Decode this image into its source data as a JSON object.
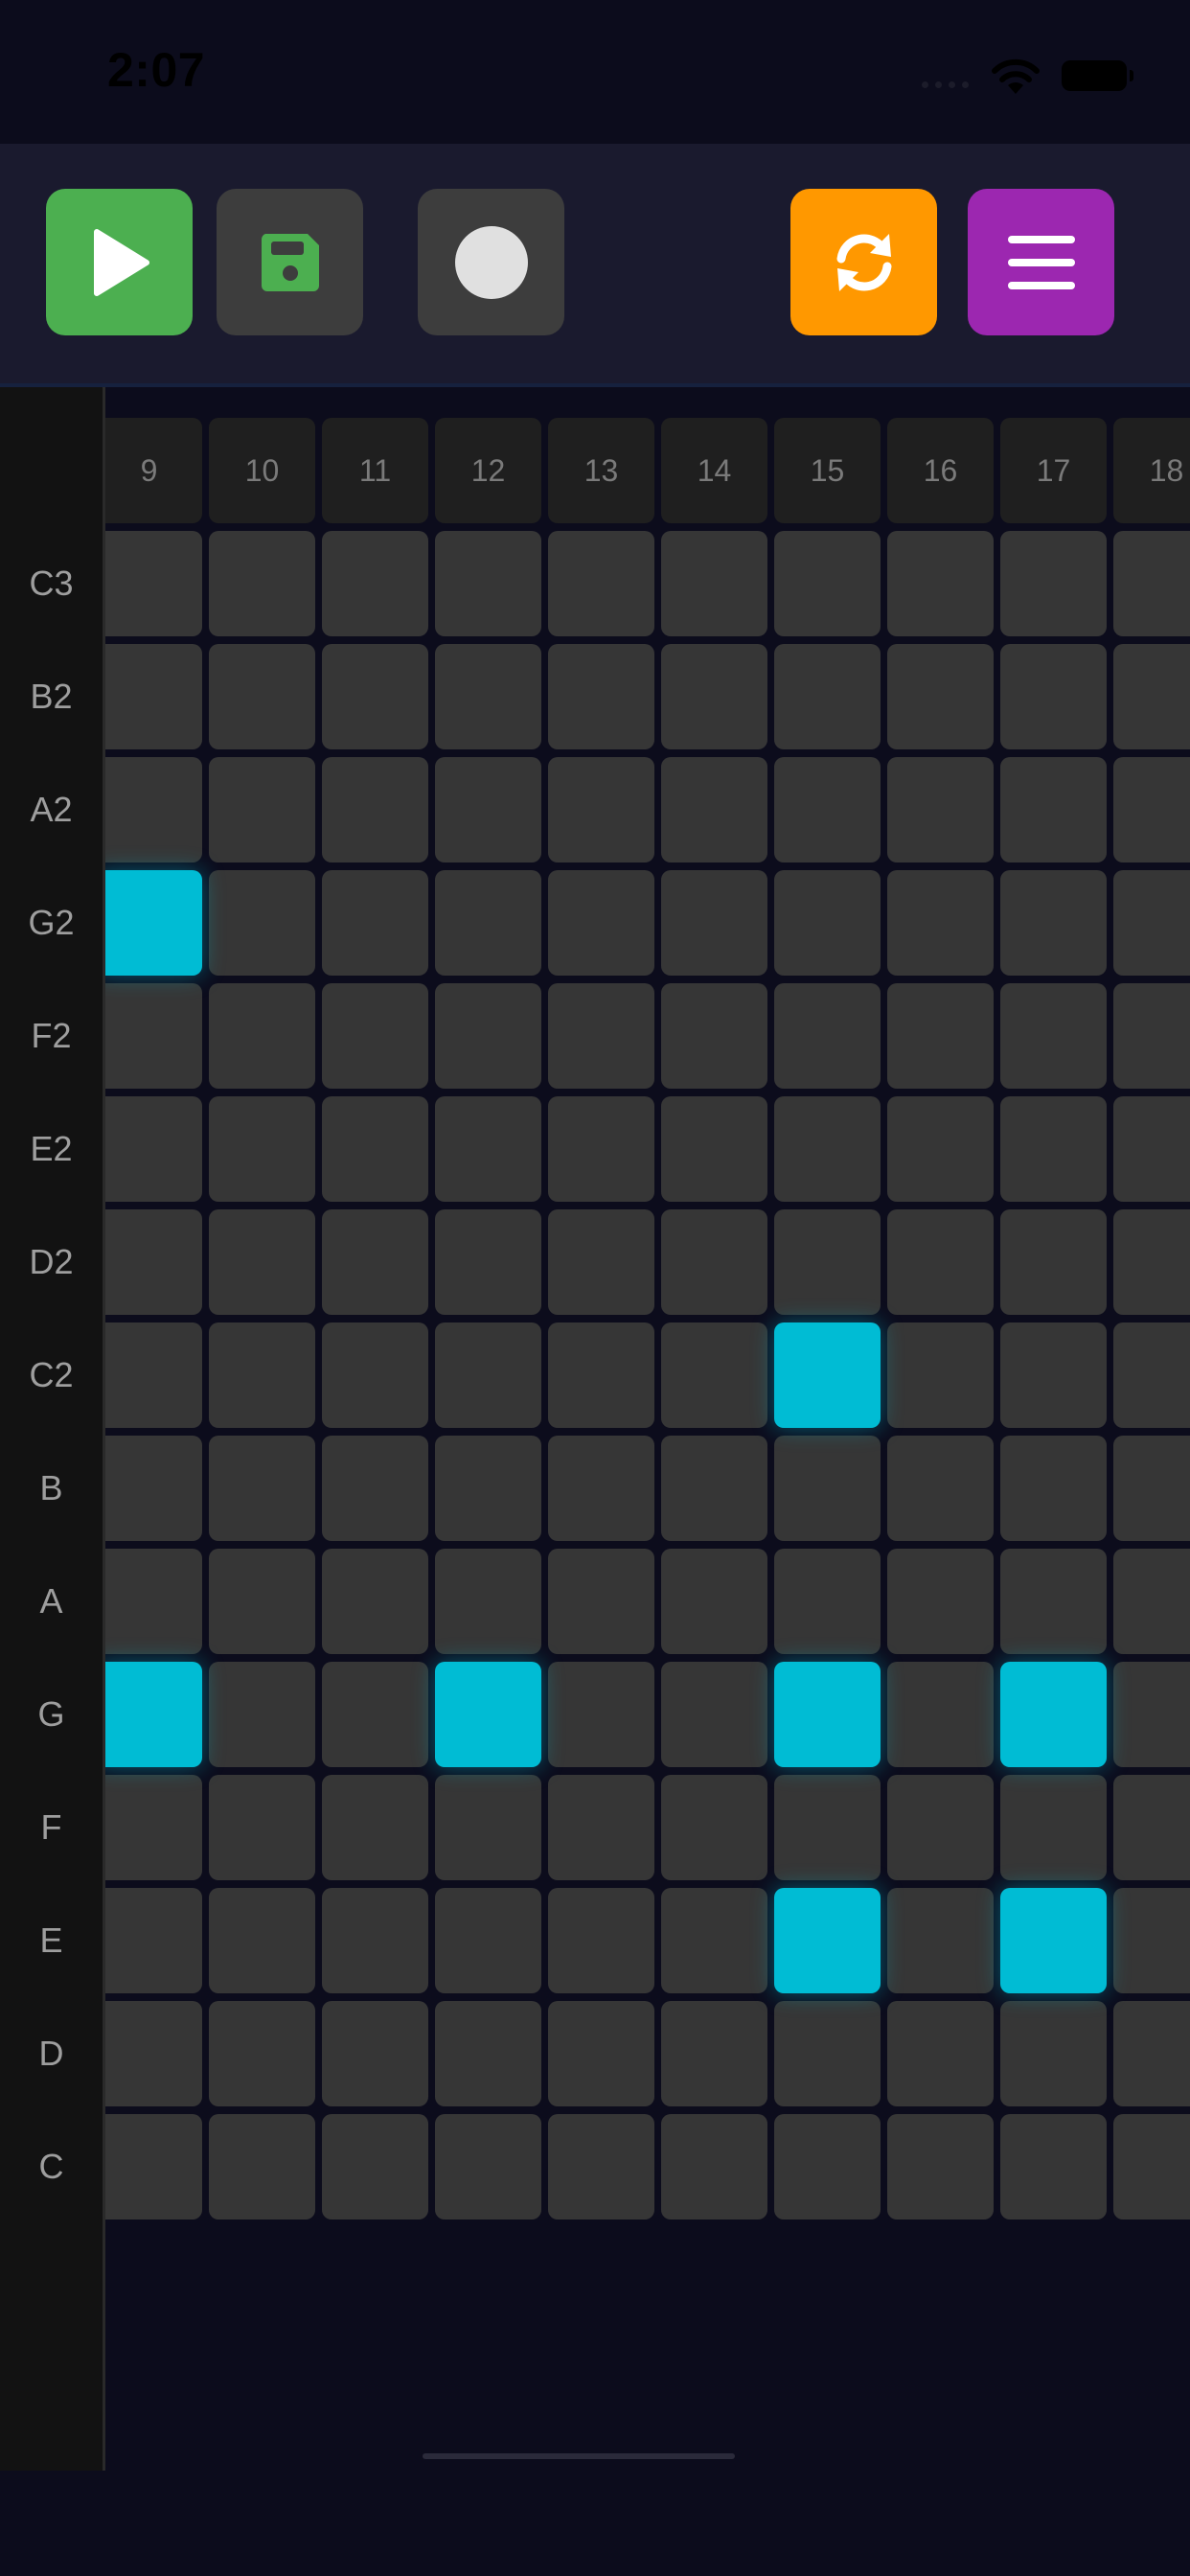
{
  "status_bar": {
    "time": "2:07"
  },
  "toolbar": {
    "buttons": [
      {
        "name": "play-button",
        "icon": "play-icon",
        "color": "#4caf50"
      },
      {
        "name": "save-button",
        "icon": "floppy-disk-icon",
        "color": "#3d3d3d"
      },
      {
        "name": "record-button",
        "icon": "record-dot-icon",
        "color": "#3d3d3d"
      },
      {
        "name": "loop-button",
        "icon": "refresh-icon",
        "color": "#ff9800"
      },
      {
        "name": "menu-button",
        "icon": "hamburger-menu-icon",
        "color": "#9c27b0"
      }
    ]
  },
  "sequencer": {
    "steps": [
      "9",
      "10",
      "11",
      "12",
      "13",
      "14",
      "15",
      "16",
      "17",
      "18"
    ],
    "notes": [
      "C3",
      "B2",
      "A2",
      "G2",
      "F2",
      "E2",
      "D2",
      "C2",
      "B",
      "A",
      "G",
      "F",
      "E",
      "D",
      "C"
    ],
    "active_cells": [
      {
        "note": "G2",
        "step": "9"
      },
      {
        "note": "C2",
        "step": "15"
      },
      {
        "note": "G",
        "step": "9"
      },
      {
        "note": "G",
        "step": "12"
      },
      {
        "note": "G",
        "step": "15"
      },
      {
        "note": "G",
        "step": "17"
      },
      {
        "note": "E",
        "step": "15"
      },
      {
        "note": "E",
        "step": "17"
      }
    ],
    "colors": {
      "active": "#00bcd4",
      "inactive": "#363636",
      "header": "#1f1f1f"
    }
  }
}
